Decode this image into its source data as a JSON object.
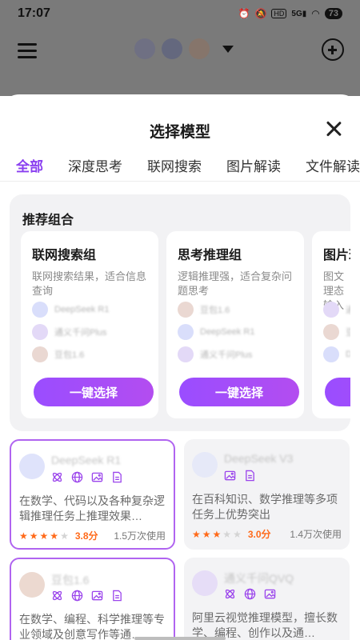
{
  "status": {
    "time": "17:07",
    "icons": [
      "alarm-icon",
      "mute-icon",
      "hd-icon",
      "5g-icon",
      "wifi-icon"
    ],
    "battery": "73"
  },
  "sheet": {
    "title": "选择模型",
    "tabs": [
      "全部",
      "深度思考",
      "联网搜索",
      "图片解读",
      "文件解读"
    ],
    "recommend_title": "推荐组合",
    "combos": [
      {
        "name": "联网搜索组",
        "desc": "联网搜索结果，适合信息查询",
        "items": [
          "DeepSeek R1",
          "通义千问Plus",
          "豆包1.6"
        ],
        "button": "一键选择"
      },
      {
        "name": "思考推理组",
        "desc": "逻辑推理强，适合复杂问题思考",
        "items": [
          "豆包1.6",
          "DeepSeek R1",
          "通义千问Plus"
        ],
        "button": "一键选择"
      },
      {
        "name": "图片理",
        "desc": "图文理态输入",
        "items": [
          "通",
          "豆",
          "D"
        ],
        "button": ""
      }
    ],
    "models": [
      {
        "name": "DeepSeek R1",
        "desc": "在数学、代码以及各种复杂逻辑推理任务上推理效果…",
        "stars": 4,
        "score": "3.8分",
        "uses": "1.5万次使用",
        "selected": true,
        "logo": "#d9defb"
      },
      {
        "name": "DeepSeek V3",
        "desc": "在百科知识、数学推理等多项任务上优势突出",
        "stars": 3,
        "score": "3.0分",
        "uses": "1.4万次使用",
        "selected": false,
        "logo": "#d9defb"
      },
      {
        "name": "豆包1.6",
        "desc": "在数学、编程、科学推理等专业领域及创意写作等通…",
        "stars": 0,
        "score": "",
        "uses": "",
        "selected": true,
        "logo": "#ead8d2"
      },
      {
        "name": "通义千问QVQ",
        "desc": "阿里云视觉推理模型，擅长数学、编程、创作以及通…",
        "stars": 0,
        "score": "",
        "uses": "",
        "selected": false,
        "logo": "#e3d9f7"
      }
    ]
  }
}
